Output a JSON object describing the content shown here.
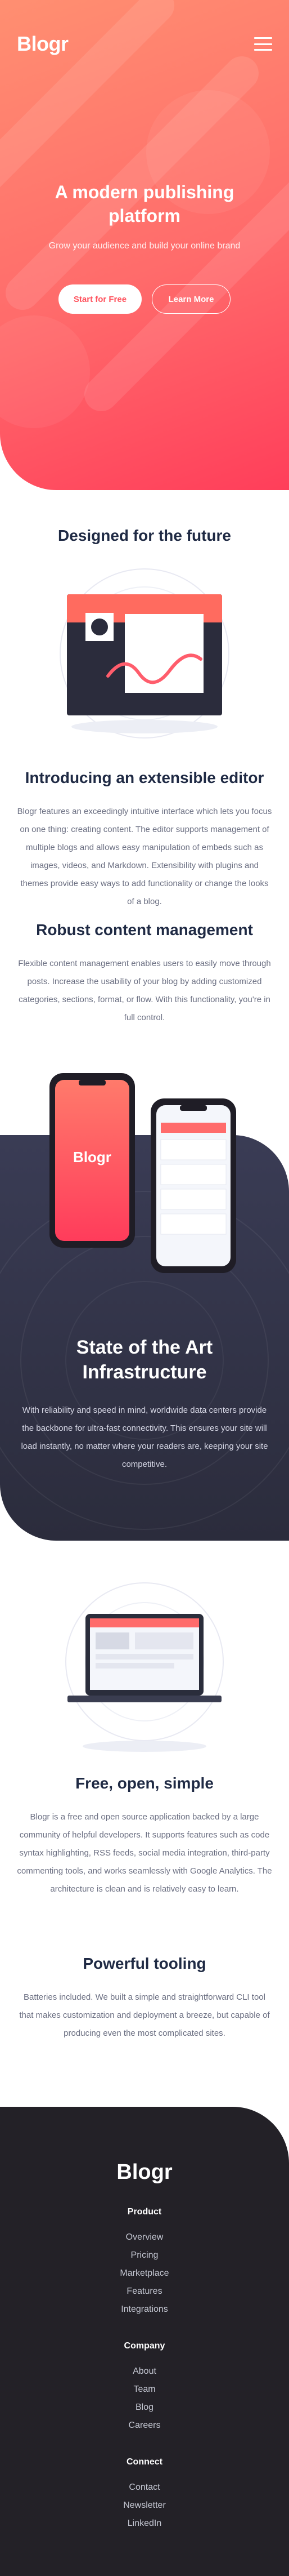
{
  "header": {
    "logo": "Blogr",
    "menu_icon": "hamburger-menu-icon"
  },
  "hero": {
    "title": "A modern publishing platform",
    "subtitle": "Grow your audience and build your online brand",
    "primary_button": "Start for Free",
    "secondary_button": "Learn More"
  },
  "designed": {
    "title": "Designed for the future"
  },
  "features": [
    {
      "title": "Introducing an extensible editor",
      "body": "Blogr features an exceedingly intuitive interface which lets you focus on one thing: creating content. The editor supports management of multiple blogs and allows easy manipulation of embeds such as images, videos, and Markdown. Extensibility with plugins and themes provide easy ways to add functionality or change the looks of a blog."
    },
    {
      "title": "Robust content management",
      "body": "Flexible content management enables users to easily move through posts. Increase the usability of your blog by adding customized categories, sections, format, or flow. With this functionality, you're in full control."
    }
  ],
  "phone": {
    "logo": "Blogr"
  },
  "infra": {
    "title": "State of the Art Infrastructure",
    "body": "With reliability and speed in mind, worldwide data centers provide the backbone for ultra-fast connectivity. This ensures your site will load instantly, no matter where your readers are, keeping your site competitive."
  },
  "features2": [
    {
      "title": "Free, open, simple",
      "body": "Blogr is a free and open source application backed by a large community of helpful developers. It supports features such as code syntax highlighting, RSS feeds, social media integration, third-party commenting tools, and works seamlessly with Google Analytics. The architecture is clean and is relatively easy to learn."
    },
    {
      "title": "Powerful tooling",
      "body": "Batteries included. We built a simple and straightforward CLI tool that makes customization and deployment a breeze, but capable of producing even the most complicated sites."
    }
  ],
  "footer": {
    "logo": "Blogr",
    "columns": [
      {
        "heading": "Product",
        "links": [
          "Overview",
          "Pricing",
          "Marketplace",
          "Features",
          "Integrations"
        ]
      },
      {
        "heading": "Company",
        "links": [
          "About",
          "Team",
          "Blog",
          "Careers"
        ]
      },
      {
        "heading": "Connect",
        "links": [
          "Contact",
          "Newsletter",
          "LinkedIn"
        ]
      }
    ]
  },
  "colors": {
    "brand_coral": "#ff6b6b",
    "brand_red": "#ff525d",
    "dark_navy": "#1f2a44",
    "footer_bg": "#232127",
    "infra_bg": "#3a3c55"
  }
}
